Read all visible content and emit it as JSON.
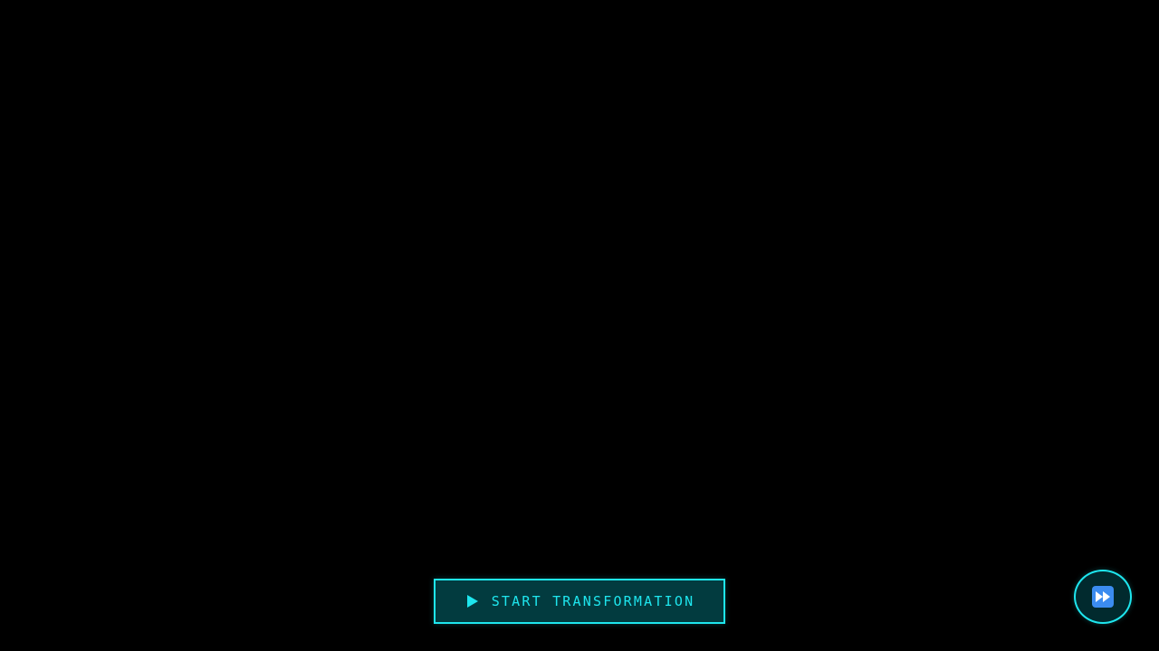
{
  "start_button": {
    "label": "START TRANSFORMATION",
    "icon": "play-icon"
  },
  "skip_button": {
    "icon": "fast-forward-icon"
  },
  "colors": {
    "background": "#000000",
    "accent": "#1ee6ee",
    "button_fill": "#023b3f",
    "fast_forward_icon_bg": "#3b8cf0"
  }
}
